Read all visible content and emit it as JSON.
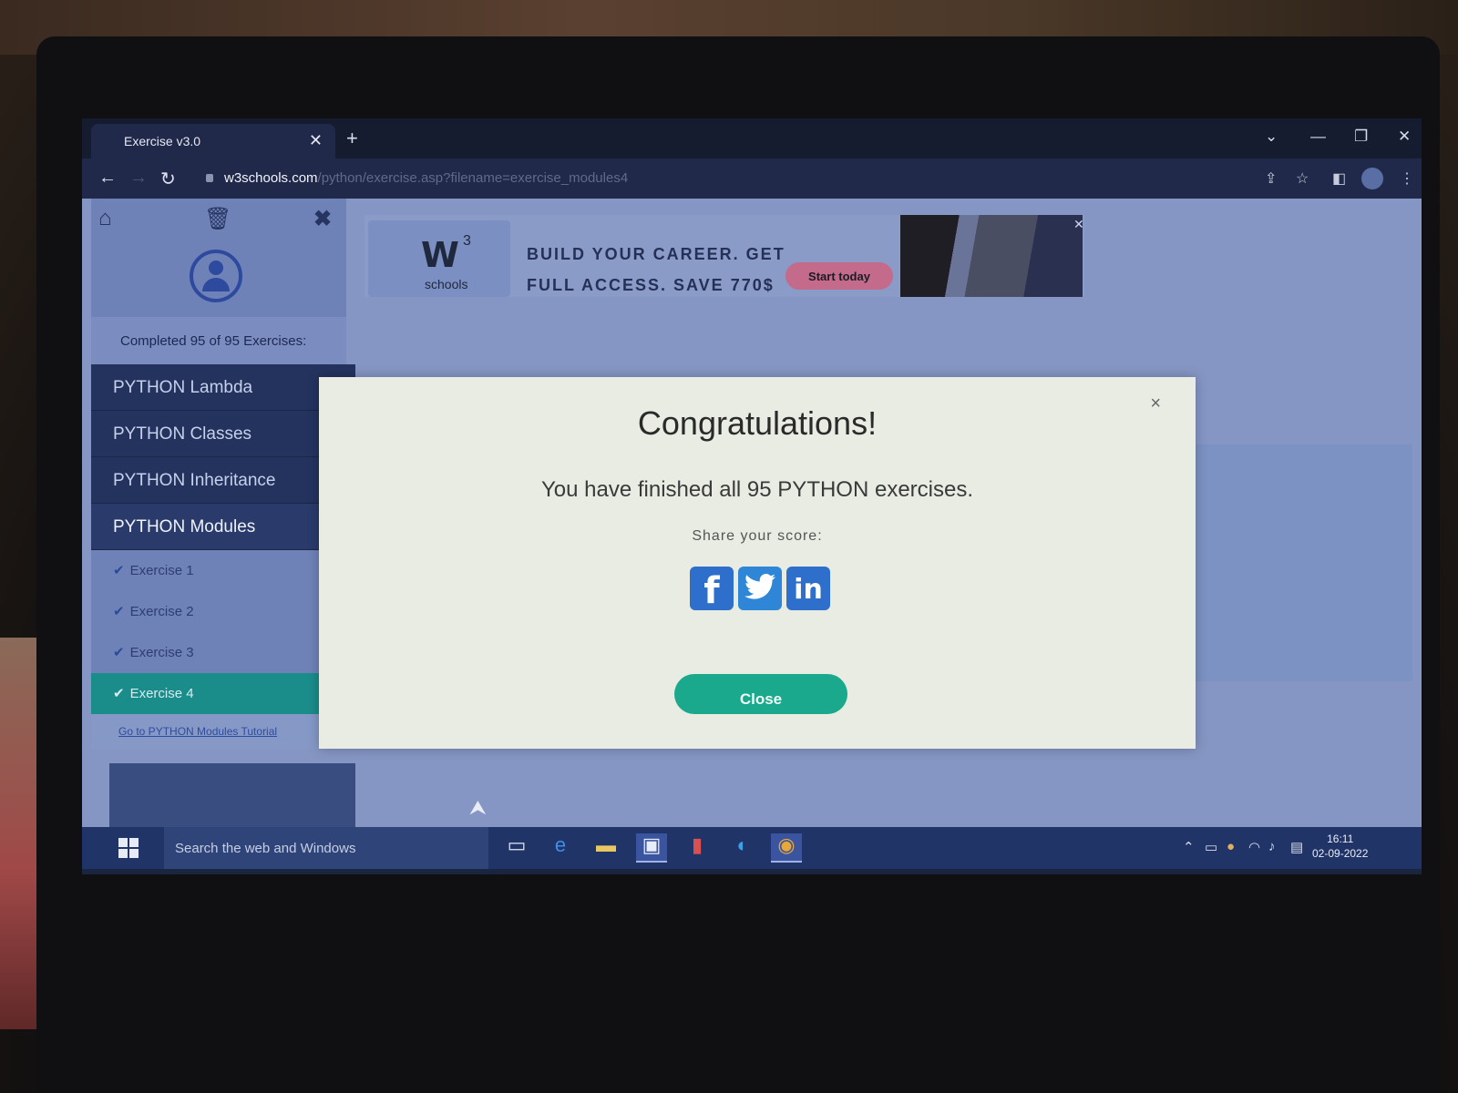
{
  "browser": {
    "tab_title": "Exercise v3.0",
    "url_host": "w3schools.com",
    "url_path": "/python/exercise.asp?filename=exercise_modules4"
  },
  "sidebar": {
    "completed_text": "Completed 95 of 95 Exercises:",
    "menu": [
      {
        "label": "PYTHON Lambda"
      },
      {
        "label": "PYTHON Classes"
      },
      {
        "label": "PYTHON Inheritance"
      },
      {
        "label": "PYTHON Modules"
      }
    ],
    "exercises": [
      "Exercise 1",
      "Exercise 2",
      "Exercise 3",
      "Exercise 4"
    ],
    "tutorial_link": "Go to PYTHON Modules Tutorial"
  },
  "ad": {
    "brand_top": "3",
    "brand_bottom": "schools",
    "line1": "BUILD YOUR CAREER. GET",
    "line2": "FULL ACCESS. SAVE 770$",
    "cta": "Start today"
  },
  "modal": {
    "title": "Congratulations!",
    "message": "You have finished all 95 PYTHON exercises.",
    "share_label": "Share your score:",
    "close_label": "Close",
    "close_x": "×"
  },
  "taskbar": {
    "search_placeholder": "Search the web and Windows",
    "time": "16:11",
    "date": "02-09-2022"
  },
  "colors": {
    "accent": "#1aa98c",
    "selected_exercise": "#1a8d8a",
    "social_blue": "#2f6fcc"
  }
}
